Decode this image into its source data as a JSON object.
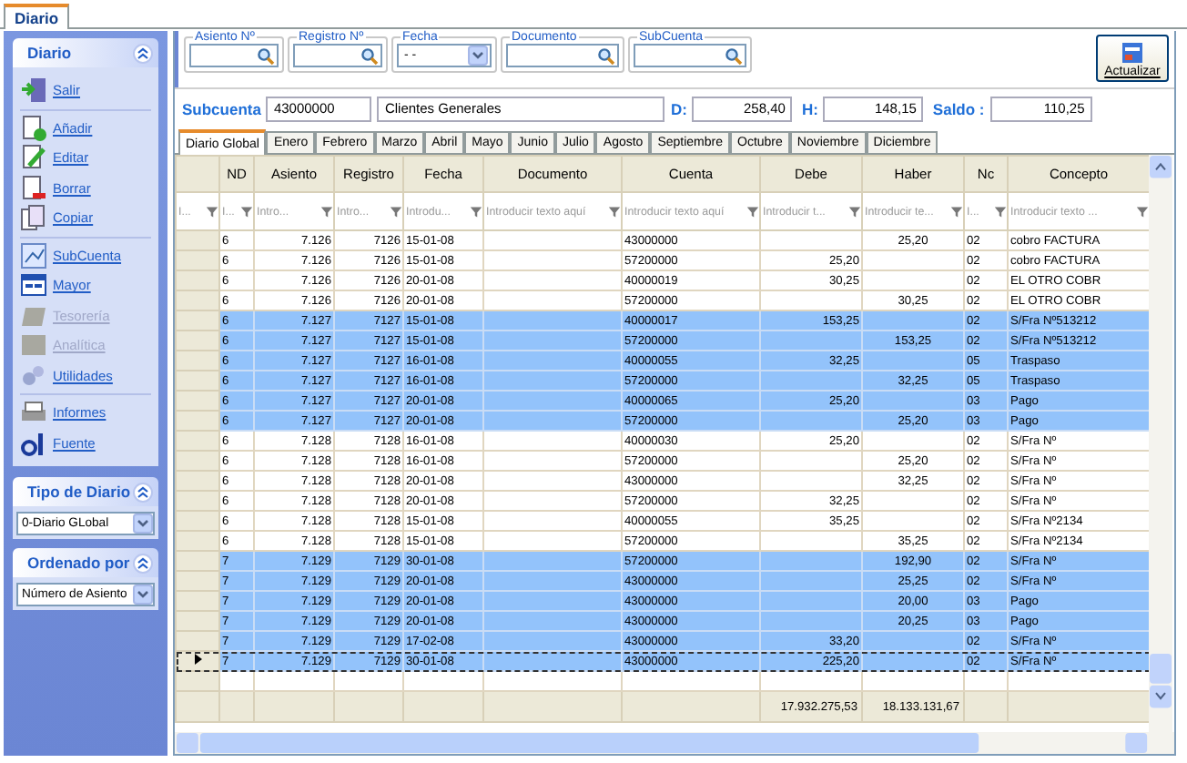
{
  "window_tab": {
    "label": "Diario",
    "selected": true
  },
  "sidebar": {
    "panels": [
      {
        "kind": "menu",
        "title": "Diario",
        "groups": [
          {
            "items": [
              {
                "label": "Salir",
                "disabled": false
              }
            ]
          },
          {
            "items": [
              {
                "label": "Añadir",
                "disabled": false
              },
              {
                "label": "Editar",
                "disabled": false
              },
              {
                "label": "Borrar",
                "disabled": false
              },
              {
                "label": "Copiar",
                "disabled": false
              }
            ]
          },
          {
            "items": [
              {
                "label": "SubCuenta",
                "disabled": false
              },
              {
                "label": "Mayor",
                "disabled": false
              },
              {
                "label": "Tesorería",
                "disabled": true
              },
              {
                "label": "Analítica",
                "disabled": true
              },
              {
                "label": "Utilidades",
                "disabled": false
              }
            ]
          },
          {
            "items": [
              {
                "label": "Informes",
                "disabled": false
              },
              {
                "label": "Fuente",
                "disabled": false
              }
            ]
          }
        ]
      },
      {
        "kind": "select",
        "title": "Tipo de Diario",
        "value": "0-Diario GLobal"
      },
      {
        "kind": "select",
        "title": "Ordenado por",
        "value": "Número de Asiento"
      }
    ]
  },
  "filters": [
    {
      "label": "Asiento Nº",
      "kind": "search"
    },
    {
      "label": "Registro Nº",
      "kind": "search"
    },
    {
      "label": "Fecha",
      "kind": "date",
      "value": "- -"
    },
    {
      "label": "Documento",
      "kind": "search"
    },
    {
      "label": "SubCuenta",
      "kind": "search"
    }
  ],
  "refresh_button": "Actualizar",
  "subcuenta": {
    "label": "Subcuenta",
    "code": "43000000",
    "name": "Clientes Generales",
    "debe_label": "D:",
    "debe": "258,40",
    "haber_label": "H:",
    "haber": "148,15",
    "saldo_label": "Saldo :",
    "saldo": "110,25"
  },
  "month_tabs": [
    {
      "label": "Diario Global",
      "selected": true
    },
    {
      "label": "Enero",
      "selected": false
    },
    {
      "label": "Febrero",
      "selected": false
    },
    {
      "label": "Marzo",
      "selected": false
    },
    {
      "label": "Abril",
      "selected": false
    },
    {
      "label": "Mayo",
      "selected": false
    },
    {
      "label": "Junio",
      "selected": false
    },
    {
      "label": "Julio",
      "selected": false
    },
    {
      "label": "Agosto",
      "selected": false
    },
    {
      "label": "Septiembre",
      "selected": false
    },
    {
      "label": "Octubre",
      "selected": false
    },
    {
      "label": "Noviembre",
      "selected": false
    },
    {
      "label": "Diciembre",
      "selected": false
    }
  ],
  "table": {
    "columns": [
      {
        "placeholder": "I..."
      },
      {
        "label": "ND",
        "placeholder": "I..."
      },
      {
        "label": "Asiento",
        "placeholder": "Intro..."
      },
      {
        "label": "Registro",
        "placeholder": "Intro..."
      },
      {
        "label": "Fecha",
        "placeholder": "Introdu..."
      },
      {
        "label": "Documento",
        "placeholder": "Introducir texto aquí"
      },
      {
        "label": "Cuenta",
        "placeholder": "Introducir texto aquí"
      },
      {
        "label": "Debe",
        "placeholder": "Introducir t..."
      },
      {
        "label": "Haber",
        "placeholder": "Introducir te..."
      },
      {
        "label": "Nc",
        "placeholder": "I..."
      },
      {
        "label": "Concepto",
        "placeholder": "Introducir texto ..."
      }
    ],
    "rows": [
      {
        "nd": "6",
        "asiento": "7.126",
        "registro": "7126",
        "fecha": "15-01-08",
        "cuenta": "43000000",
        "haber": "25,20",
        "nc": "02",
        "concepto": "cobro FACTURA",
        "selected": false,
        "current": false
      },
      {
        "nd": "6",
        "asiento": "7.126",
        "registro": "7126",
        "fecha": "15-01-08",
        "cuenta": "57200000",
        "debe": "25,20",
        "nc": "02",
        "concepto": "cobro FACTURA",
        "selected": false,
        "current": false
      },
      {
        "nd": "6",
        "asiento": "7.126",
        "registro": "7126",
        "fecha": "20-01-08",
        "cuenta": "40000019",
        "debe": "30,25",
        "nc": "02",
        "concepto": "EL OTRO COBR",
        "selected": false,
        "current": false
      },
      {
        "nd": "6",
        "asiento": "7.126",
        "registro": "7126",
        "fecha": "20-01-08",
        "cuenta": "57200000",
        "haber": "30,25",
        "nc": "02",
        "concepto": "EL OTRO COBR",
        "selected": false,
        "current": false
      },
      {
        "nd": "6",
        "asiento": "7.127",
        "registro": "7127",
        "fecha": "15-01-08",
        "cuenta": "40000017",
        "debe": "153,25",
        "nc": "02",
        "concepto": "S/Fra Nº513212",
        "selected": true,
        "current": false
      },
      {
        "nd": "6",
        "asiento": "7.127",
        "registro": "7127",
        "fecha": "15-01-08",
        "cuenta": "57200000",
        "haber": "153,25",
        "nc": "02",
        "concepto": "S/Fra Nº513212",
        "selected": true,
        "current": false
      },
      {
        "nd": "6",
        "asiento": "7.127",
        "registro": "7127",
        "fecha": "16-01-08",
        "cuenta": "40000055",
        "debe": "32,25",
        "nc": "05",
        "concepto": "Traspaso",
        "selected": true,
        "current": false
      },
      {
        "nd": "6",
        "asiento": "7.127",
        "registro": "7127",
        "fecha": "16-01-08",
        "cuenta": "57200000",
        "haber": "32,25",
        "nc": "05",
        "concepto": "Traspaso",
        "selected": true,
        "current": false
      },
      {
        "nd": "6",
        "asiento": "7.127",
        "registro": "7127",
        "fecha": "20-01-08",
        "cuenta": "40000065",
        "debe": "25,20",
        "nc": "03",
        "concepto": "Pago",
        "selected": true,
        "current": false
      },
      {
        "nd": "6",
        "asiento": "7.127",
        "registro": "7127",
        "fecha": "20-01-08",
        "cuenta": "57200000",
        "haber": "25,20",
        "nc": "03",
        "concepto": "Pago",
        "selected": true,
        "current": false
      },
      {
        "nd": "6",
        "asiento": "7.128",
        "registro": "7128",
        "fecha": "16-01-08",
        "cuenta": "40000030",
        "debe": "25,20",
        "nc": "02",
        "concepto": "S/Fra Nº",
        "selected": false,
        "current": false
      },
      {
        "nd": "6",
        "asiento": "7.128",
        "registro": "7128",
        "fecha": "16-01-08",
        "cuenta": "57200000",
        "haber": "25,20",
        "nc": "02",
        "concepto": "S/Fra Nº",
        "selected": false,
        "current": false
      },
      {
        "nd": "6",
        "asiento": "7.128",
        "registro": "7128",
        "fecha": "20-01-08",
        "cuenta": "43000000",
        "haber": "32,25",
        "nc": "02",
        "concepto": "S/Fra Nº",
        "selected": false,
        "current": false
      },
      {
        "nd": "6",
        "asiento": "7.128",
        "registro": "7128",
        "fecha": "20-01-08",
        "cuenta": "57200000",
        "debe": "32,25",
        "nc": "02",
        "concepto": "S/Fra Nº",
        "selected": false,
        "current": false
      },
      {
        "nd": "6",
        "asiento": "7.128",
        "registro": "7128",
        "fecha": "15-01-08",
        "cuenta": "40000055",
        "debe": "35,25",
        "nc": "02",
        "concepto": "S/Fra Nº2134",
        "selected": false,
        "current": false
      },
      {
        "nd": "6",
        "asiento": "7.128",
        "registro": "7128",
        "fecha": "15-01-08",
        "cuenta": "57200000",
        "haber": "35,25",
        "nc": "02",
        "concepto": "S/Fra Nº2134",
        "selected": false,
        "current": false
      },
      {
        "nd": "7",
        "asiento": "7.129",
        "registro": "7129",
        "fecha": "30-01-08",
        "cuenta": "57200000",
        "haber": "192,90",
        "nc": "02",
        "concepto": "S/Fra Nº",
        "selected": true,
        "current": false
      },
      {
        "nd": "7",
        "asiento": "7.129",
        "registro": "7129",
        "fecha": "20-01-08",
        "cuenta": "43000000",
        "haber": "25,25",
        "nc": "02",
        "concepto": "S/Fra Nº",
        "selected": true,
        "current": false
      },
      {
        "nd": "7",
        "asiento": "7.129",
        "registro": "7129",
        "fecha": "20-01-08",
        "cuenta": "43000000",
        "haber": "20,00",
        "nc": "03",
        "concepto": "Pago",
        "selected": true,
        "current": false
      },
      {
        "nd": "7",
        "asiento": "7.129",
        "registro": "7129",
        "fecha": "20-01-08",
        "cuenta": "43000000",
        "haber": "20,25",
        "nc": "03",
        "concepto": "Pago",
        "selected": true,
        "current": false
      },
      {
        "nd": "7",
        "asiento": "7.129",
        "registro": "7129",
        "fecha": "17-02-08",
        "cuenta": "43000000",
        "debe": "33,20",
        "nc": "02",
        "concepto": "S/Fra Nº",
        "selected": true,
        "current": false
      },
      {
        "nd": "7",
        "asiento": "7.129",
        "registro": "7129",
        "fecha": "30-01-08",
        "cuenta": "43000000",
        "debe": "225,20",
        "nc": "02",
        "concepto": "S/Fra Nº",
        "selected": true,
        "current": true
      }
    ],
    "totals": {
      "debe": "17.932.275,53",
      "haber": "18.133.131,67"
    }
  }
}
